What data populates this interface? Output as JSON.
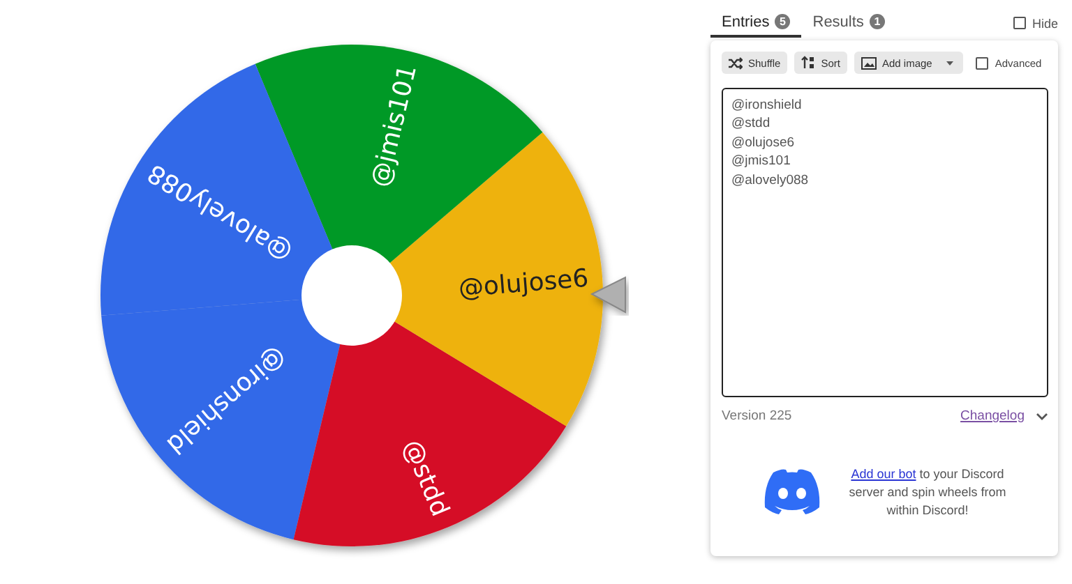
{
  "wheel": {
    "slices": [
      {
        "label": "@ironshield",
        "color": "#3369e8"
      },
      {
        "label": "@stdd",
        "color": "#d50f25"
      },
      {
        "label": "@olujose6",
        "color": "#eeb211"
      },
      {
        "label": "@jmis101",
        "color": "#009925"
      },
      {
        "label": "@alovely088",
        "color": "#3369e8"
      }
    ]
  },
  "tabs": [
    {
      "label": "Entries",
      "count": "5",
      "selected": true
    },
    {
      "label": "Results",
      "count": "1",
      "selected": false
    }
  ],
  "hide": {
    "label": "Hide",
    "checked": false
  },
  "toolbar": [
    {
      "kind": "shuffle",
      "label": "Shuffle"
    },
    {
      "kind": "sort",
      "label": "Sort"
    },
    {
      "kind": "image",
      "label": "Add image"
    }
  ],
  "advanced": {
    "label": "Advanced",
    "checked": false
  },
  "entries": [
    "@ironshield",
    "@stdd",
    "@olujose6",
    "@jmis101",
    "@alovely088"
  ],
  "version": "Version 225",
  "changelog": "Changelog",
  "discord": {
    "link": "Add our bot",
    "text": " to your Discord server and spin wheels from within Discord!"
  }
}
